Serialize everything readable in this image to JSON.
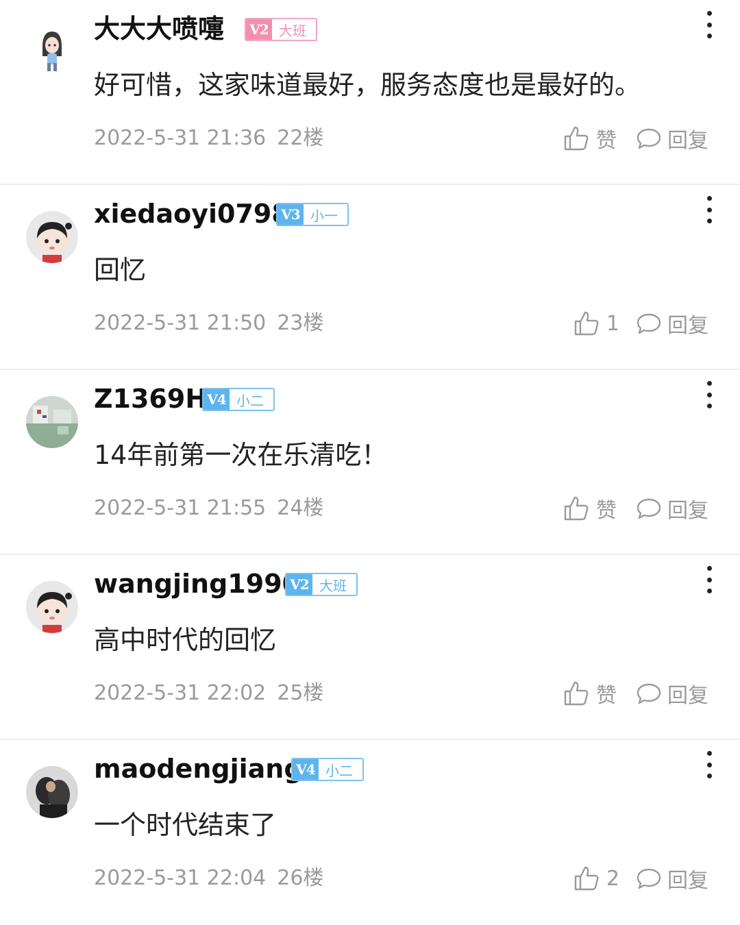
{
  "comments": [
    {
      "username": "大大大喷嚏",
      "level": "V2",
      "rank": "大班",
      "badge_color": "pink",
      "text": "好可惜，这家味道最好，服务态度也是最好的。",
      "time": "2022-5-31 21:36",
      "floor": "22楼",
      "like_label": "赞",
      "reply_label": "回复",
      "avatar": "girl-cartoon-avatar"
    },
    {
      "username": "xiedaoyi0798",
      "level": "V3",
      "rank": "小一",
      "badge_color": "blue",
      "text": "回忆",
      "time": "2022-5-31 21:50",
      "floor": "23楼",
      "like_label": "1",
      "reply_label": "回复",
      "avatar": "default-cartoon-avatar"
    },
    {
      "username": "Z1369H",
      "level": "V4",
      "rank": "小二",
      "badge_color": "blue",
      "text": "14年前第一次在乐清吃！",
      "time": "2022-5-31 21:55",
      "floor": "24楼",
      "like_label": "赞",
      "reply_label": "回复",
      "avatar": "photo-avatar"
    },
    {
      "username": "wangjing1990",
      "level": "V2",
      "rank": "大班",
      "badge_color": "blue",
      "text": "高中时代的回忆",
      "time": "2022-5-31 22:02",
      "floor": "25楼",
      "like_label": "赞",
      "reply_label": "回复",
      "avatar": "default-cartoon-avatar"
    },
    {
      "username": "maodengjiang",
      "level": "V4",
      "rank": "小二",
      "badge_color": "blue",
      "text": "一个时代结束了",
      "time": "2022-5-31 22:04",
      "floor": "26楼",
      "like_label": "2",
      "reply_label": "回复",
      "avatar": "photo-avatar-dark"
    }
  ],
  "colors": {
    "badge_blue": "#5db4ee",
    "badge_pink": "#f290ad",
    "meta_gray": "#9a9a9a"
  }
}
